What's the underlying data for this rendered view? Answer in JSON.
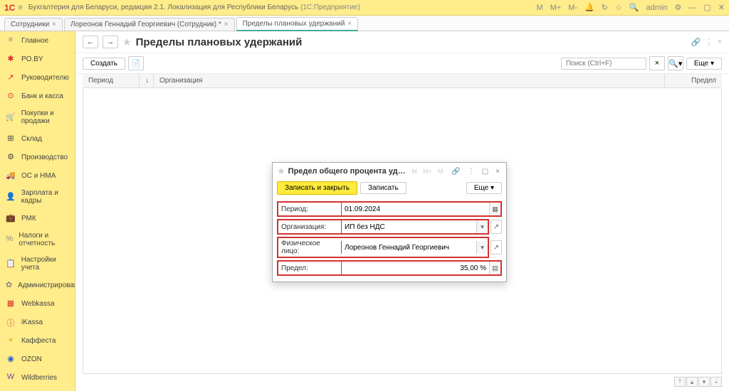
{
  "titlebar": {
    "logo": "1C",
    "title": "Бухгалтерия для Беларуси, редакция 2.1. Локализация для Республики Беларусь",
    "system": "(1С:Предприятие)",
    "m1": "M",
    "m2": "M+",
    "m3": "M-",
    "user": "admin"
  },
  "tabs": [
    {
      "label": "Сотрудники"
    },
    {
      "label": "Лореонов Геннадий Георгиевич (Сотрудник) *"
    },
    {
      "label": "Пределы плановых удержаний"
    }
  ],
  "sidebar": [
    {
      "icon": "≡",
      "label": "Главное",
      "color": "#888"
    },
    {
      "icon": "✱",
      "label": "PO.BY",
      "color": "#d63030"
    },
    {
      "icon": "↗",
      "label": "Руководителю",
      "color": "#d63030"
    },
    {
      "icon": "⊙",
      "label": "Банк и касса",
      "color": "#d63030"
    },
    {
      "icon": "🛒",
      "label": "Покупки и продажи",
      "color": "#444"
    },
    {
      "icon": "⊞",
      "label": "Склад",
      "color": "#444"
    },
    {
      "icon": "⚙",
      "label": "Производство",
      "color": "#444"
    },
    {
      "icon": "🚚",
      "label": "ОС и НМА",
      "color": "#444"
    },
    {
      "icon": "👤",
      "label": "Зарплата и кадры",
      "color": "#444"
    },
    {
      "icon": "💼",
      "label": "РМК",
      "color": "#444"
    },
    {
      "icon": "%",
      "label": "Налоги и отчетность",
      "color": "#888"
    },
    {
      "icon": "📋",
      "label": "Настройки учета",
      "color": "#444"
    },
    {
      "icon": "✿",
      "label": "Администрирование",
      "color": "#888"
    },
    {
      "icon": "▦",
      "label": "Webkassa",
      "color": "#d63030"
    },
    {
      "icon": "ⓘ",
      "label": "iKassa",
      "color": "#d63030"
    },
    {
      "icon": "●",
      "label": "Каффеста",
      "color": "#f0c040"
    },
    {
      "icon": "◉",
      "label": "OZON",
      "color": "#2060d0"
    },
    {
      "icon": "W",
      "label": "Wildberries",
      "color": "#8040a0"
    }
  ],
  "page": {
    "title": "Пределы плановых удержаний",
    "create": "Создать",
    "search_placeholder": "Поиск (Ctrl+F)",
    "more": "Еще"
  },
  "table": {
    "col_period": "Период",
    "col_org": "Организация",
    "col_limit": "Предел"
  },
  "dialog": {
    "title": "Предел общего процента удержаний ...",
    "save_close": "Записать и закрыть",
    "save": "Записать",
    "more": "Еще",
    "fields": {
      "period_label": "Период:",
      "period_value": "01.09.2024",
      "org_label": "Организация:",
      "org_value": "ИП без НДС",
      "person_label": "Физическое лицо:",
      "person_value": "Лореонов Геннадий Георгиевич",
      "limit_label": "Предел:",
      "limit_value": "35,00 %"
    }
  }
}
